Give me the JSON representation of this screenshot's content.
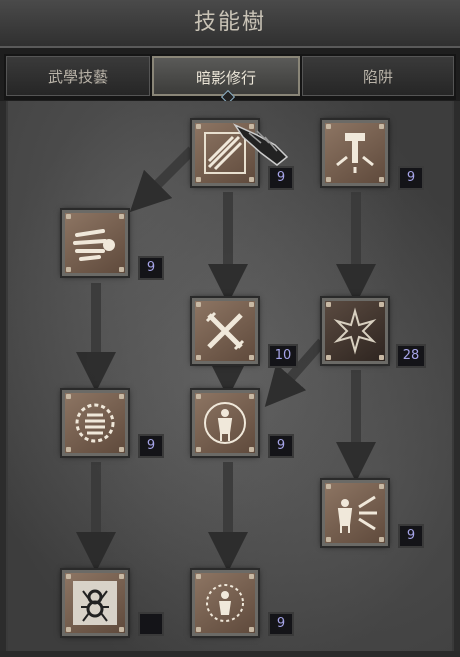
{
  "panel": {
    "title": "技能樹",
    "tabs": [
      {
        "label": "武學技藝",
        "active": false
      },
      {
        "label": "暗影修行",
        "active": true
      },
      {
        "label": "陷阱",
        "active": false
      }
    ]
  },
  "skills": [
    {
      "name": "blade-shield-skill",
      "icon": "claw-blades-icon",
      "level": "9"
    },
    {
      "name": "hammer-trap-skill",
      "icon": "hammer-trap-icon",
      "level": "9"
    },
    {
      "name": "fists-of-fire-skill",
      "icon": "fist-strike-icon",
      "level": "9"
    },
    {
      "name": "crossed-blades-skill",
      "icon": "crossed-blades-icon",
      "level": "10"
    },
    {
      "name": "star-burst-skill",
      "icon": "star-burst-icon",
      "level": "28"
    },
    {
      "name": "spiral-ring-skill",
      "icon": "spiral-ring-icon",
      "level": "9"
    },
    {
      "name": "figure-aura-skill",
      "icon": "figure-aura-icon",
      "level": "9"
    },
    {
      "name": "figure-blast-skill",
      "icon": "figure-blast-icon",
      "level": "9"
    },
    {
      "name": "spider-skill",
      "icon": "spider-icon",
      "level": ""
    },
    {
      "name": "figure-radiance-skill",
      "icon": "figure-radiance-icon",
      "level": "9"
    }
  ],
  "colors": {
    "level_text": "#a6a4e8",
    "frame": "#6b6a66",
    "icon_bg": "#8d7563"
  }
}
